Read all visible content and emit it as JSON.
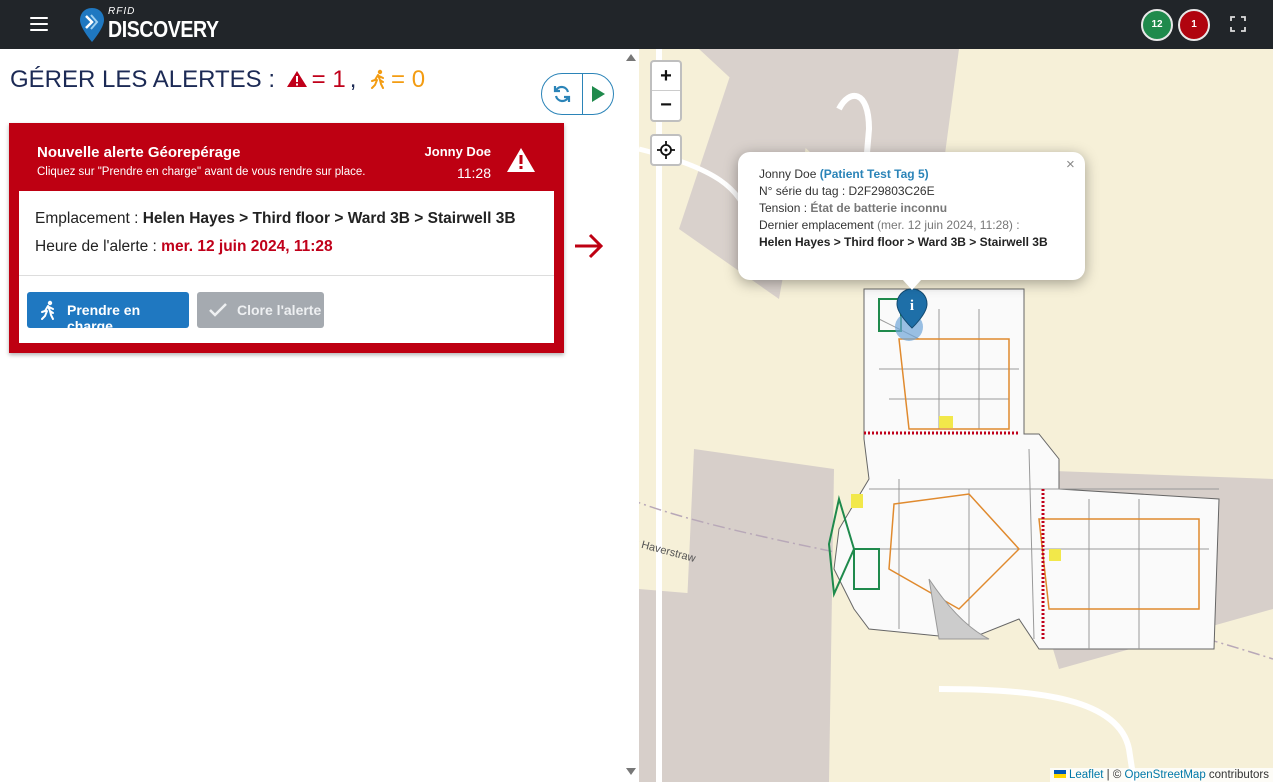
{
  "header": {
    "logo_small": "RFID",
    "logo_main": "DISCOVERY",
    "badge_green": "12",
    "badge_red": "1"
  },
  "page": {
    "title": "GÉRER LES ALERTES :",
    "alert_count_label": "= 1",
    "separator": ",",
    "running_count_label": "= 0"
  },
  "alert": {
    "title": "Nouvelle alerte Géorepérage",
    "subtitle": "Cliquez sur \"Prendre en charge\" avant de vous rendre sur place.",
    "person": "Jonny Doe",
    "time": "11:28",
    "location_label": "Emplacement : ",
    "location_value": "Helen Hayes > Third floor > Ward 3B > Stairwell 3B",
    "alert_time_label": "Heure de l'alerte : ",
    "alert_time_value": "mer. 12 juin 2024, 11:28",
    "take_button": "Prendre en charge",
    "close_button": "Clore l'alerte"
  },
  "map": {
    "zoom_in": "+",
    "zoom_out": "−",
    "street": "r Haverstraw",
    "popup": {
      "close": "×",
      "name": "Jonny Doe",
      "tag_name": "(Patient Test Tag 5)",
      "serial_label": "N° série du tag : ",
      "serial_value": "D2F29803C26E",
      "voltage_label": "Tension : ",
      "voltage_value": "État de batterie inconnu",
      "last_location_label": "Dernier emplacement",
      "last_location_date": "(mer. 12 juin 2024, 11:28) :",
      "last_location_value": "Helen Hayes > Third floor > Ward 3B > Stairwell 3B"
    },
    "attribution": {
      "leaflet": "Leaflet",
      "separator": " | © ",
      "osm": "OpenStreetMap",
      "contributors": " contributors"
    }
  },
  "colors": {
    "topbar": "#212529",
    "alert_red": "#be0012",
    "primary_blue": "#1f78c1",
    "accent_orange": "#f39c12",
    "badge_green": "#1f8a4c",
    "badge_red": "#b0040f"
  }
}
